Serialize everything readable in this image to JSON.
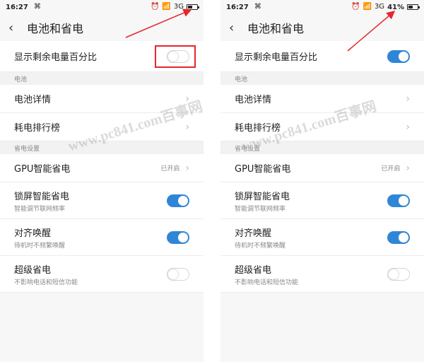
{
  "colors": {
    "accent": "#2f86d6",
    "highlight": "#e6262d",
    "arrow": "#e6262d"
  },
  "watermark": "www.pc841.com百事网",
  "screens": [
    {
      "id": "left",
      "status": {
        "time": "16:27",
        "network": "3G",
        "battery_text": ""
      },
      "header": {
        "back_icon": "back-arrow-icon",
        "title": "电池和省电"
      },
      "top_toggle": {
        "label": "显示剩余电量百分比",
        "on": false,
        "highlighted": true
      },
      "section_battery": "电池",
      "battery_items": [
        {
          "label": "电池详情"
        },
        {
          "label": "耗电排行榜"
        }
      ],
      "section_saving": "省电设置",
      "gpu": {
        "label": "GPU智能省电",
        "status": "已开启"
      },
      "toggles": [
        {
          "label": "锁屏智能省电",
          "sub": "智能调节联网频率",
          "on": true
        },
        {
          "label": "对齐唤醒",
          "sub": "待机时不频繁唤醒",
          "on": true
        },
        {
          "label": "超级省电",
          "sub": "不影响电话和短信功能",
          "on": false
        }
      ]
    },
    {
      "id": "right",
      "status": {
        "time": "16:27",
        "network": "3G",
        "battery_text": "41%"
      },
      "header": {
        "back_icon": "back-arrow-icon",
        "title": "电池和省电"
      },
      "top_toggle": {
        "label": "显示剩余电量百分比",
        "on": true,
        "highlighted": false
      },
      "section_battery": "电池",
      "battery_items": [
        {
          "label": "电池详情"
        },
        {
          "label": "耗电排行榜"
        }
      ],
      "section_saving": "省电设置",
      "gpu": {
        "label": "GPU智能省电",
        "status": "已开启"
      },
      "toggles": [
        {
          "label": "锁屏智能省电",
          "sub": "智能调节联网频率",
          "on": true
        },
        {
          "label": "对齐唤醒",
          "sub": "待机时不频繁唤醒",
          "on": true
        },
        {
          "label": "超级省电",
          "sub": "不影响电话和短信功能",
          "on": false
        }
      ]
    }
  ]
}
